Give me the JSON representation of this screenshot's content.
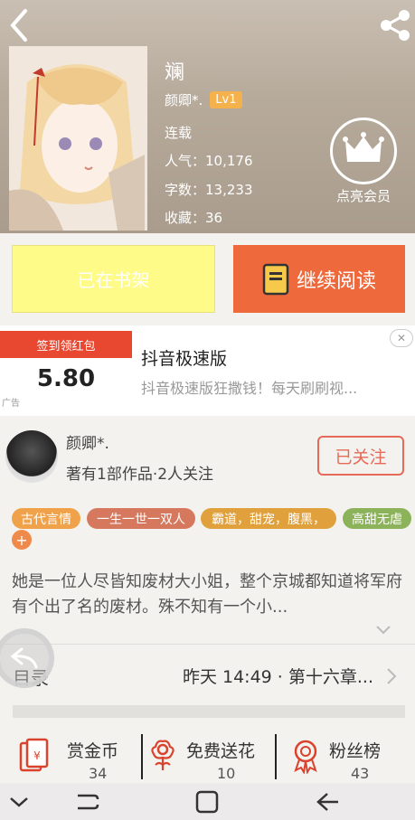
{
  "header": {
    "book_title": "斓",
    "author": "颜卿*.",
    "level": "Lv1",
    "status": "连载",
    "stats": [
      {
        "label": "人气：",
        "value": "10,176"
      },
      {
        "label": "字数：",
        "value": "13,233"
      },
      {
        "label": "收藏：",
        "value": "36"
      }
    ],
    "vip_label": "点亮会员"
  },
  "actions": {
    "shelf_label": "已在书架",
    "read_label": "继续阅读"
  },
  "ad": {
    "banner_top": "签到领红包",
    "amount": "5.80",
    "tag": "广告",
    "title": "抖音极速版",
    "description": "抖音极速版狂撒钱！每天刷刷视..."
  },
  "author_card": {
    "name": "颜卿*.",
    "info": "著有1部作品·2人关注",
    "follow_label": "已关注"
  },
  "tags": [
    {
      "label": "古代言情",
      "color": "#f0a24b"
    },
    {
      "label": "一生一世一双人",
      "color": "#d6785e"
    },
    {
      "label": "霸道，甜宠，腹黑，",
      "color": "#e0a13d"
    },
    {
      "label": "高甜无虐",
      "color": "#8cb25a"
    }
  ],
  "tag_add": "+",
  "description": "她是一位人尽皆知废材大小姐，整个京城都知道将军府有个出了名的废材。殊不知有一个小...",
  "catalog": {
    "label": "目录",
    "latest": "昨天 14:49 · 第十六章..."
  },
  "bottom_stats": [
    {
      "name": "赏金币",
      "value": "34"
    },
    {
      "name": "免费送花",
      "value": "10"
    },
    {
      "name": "粉丝榜",
      "value": "43"
    }
  ],
  "colors": {
    "accent": "#ee6a3d",
    "shelf": "#fffb88",
    "follow": "#e56a57",
    "icon_red": "#d9432d"
  }
}
